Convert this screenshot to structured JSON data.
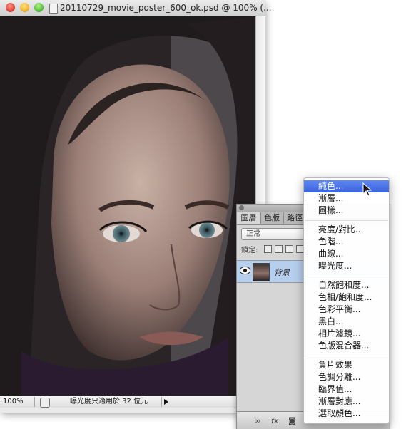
{
  "document": {
    "title": "20110729_movie_poster_600_ok.psd @ 100% (...",
    "zoom": "100%",
    "status_text": "曝光度只適用於 32 位元"
  },
  "layers_panel": {
    "tabs": [
      "圖層",
      "色版",
      "路徑"
    ],
    "blend_mode": "正常",
    "lock_label": "鎖定:",
    "layer_name": "背景",
    "bottom_icons": [
      "link-icon",
      "fx-icon",
      "mask-icon"
    ]
  },
  "adjustment_menu": {
    "groups": [
      [
        "純色...",
        "漸層...",
        "圖樣..."
      ],
      [
        "亮度/對比...",
        "色階...",
        "曲線...",
        "曝光度..."
      ],
      [
        "自然飽和度...",
        "色相/飽和度...",
        "色彩平衡...",
        "黑白...",
        "相片濾鏡...",
        "色版混合器..."
      ],
      [
        "負片效果",
        "色調分離...",
        "臨界值...",
        "漸層對應...",
        "選取顏色..."
      ]
    ],
    "highlighted": "純色..."
  }
}
